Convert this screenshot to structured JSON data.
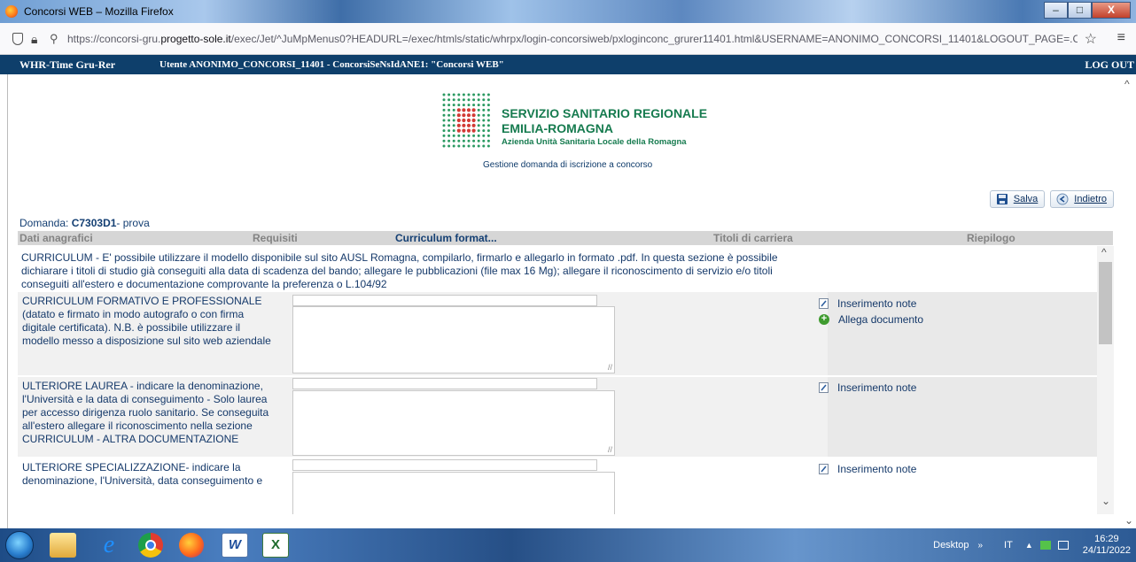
{
  "window": {
    "title": "Concorsi WEB – Mozilla Firefox",
    "minimize": "–",
    "maximize": "□",
    "close": "X"
  },
  "address_bar": {
    "url_prefix": "https://concorsi-gru.",
    "url_domain": "progetto-sole.it",
    "url_suffix": "/exec/Jet/^JuMpMenus0?HEADURL=/exec/htmls/static/whrpx/login-concorsiweb/pxloginconc_grurer11401.html&USERNAME=ANONIMO_CONCORSI_11401&LOGOUT_PAGE=.CLOSE&N",
    "bookmark_icon": "star-icon",
    "menu_icon": "hamburger-icon"
  },
  "app_header": {
    "app_name": "WHR-Time Gru-Rer",
    "user_text": "Utente ANONIMO_CONCORSI_11401 - ConcorsiSeNsIdANE1: \"Concorsi WEB\"",
    "logout": "LOG OUT"
  },
  "logo": {
    "line1": "SERVIZIO SANITARIO REGIONALE",
    "line2": "EMILIA-ROMAGNA",
    "line3": "Azienda Unità Sanitaria Locale della Romagna"
  },
  "subtitle": "Gestione domanda di iscrizione a concorso",
  "toolbar": {
    "save_label": "Salva",
    "back_label": "Indietro"
  },
  "domanda": {
    "label": "Domanda:",
    "code": "C7303D1",
    "suffix": "- prova"
  },
  "tabs": [
    {
      "label": "Dati anagrafici"
    },
    {
      "label": "Requisiti"
    },
    {
      "label": "Curriculum format..."
    },
    {
      "label": "Titoli di carriera"
    },
    {
      "label": "Riepilogo"
    }
  ],
  "active_tab": "Curriculum format...",
  "intro": "CURRICULUM - E' possibile utilizzare il modello disponibile sul sito AUSL Romagna, compilarlo, firmarlo e allegarlo in formato .pdf. In questa sezione è possibile dichiarare i titoli di studio già conseguiti alla data di scadenza del bando; allegare le pubblicazioni (file max 16 Mg); allegare il riconoscimento di servizio e/o titoli conseguiti all'estero e documentazione comprovante la preferenza o L.104/92",
  "rows": [
    {
      "label": "CURRICULUM FORMATIVO E PROFESSIONALE (datato e firmato in modo autografo o con firma digitale certificata). N.B. è possibile utilizzare il modello messo a disposizione sul sito web aziendale",
      "input_value": "",
      "textarea_value": "",
      "actions": [
        "Inserimento note",
        "Allega documento"
      ]
    },
    {
      "label": "ULTERIORE LAUREA - indicare la denominazione, l'Università e la data di conseguimento - Solo laurea per accesso dirigenza ruolo sanitario. Se conseguita all'estero allegare il riconoscimento nella sezione CURRICULUM - ALTRA DOCUMENTAZIONE",
      "input_value": "",
      "textarea_value": "",
      "actions": [
        "Inserimento note"
      ]
    },
    {
      "label": "ULTERIORE SPECIALIZZAZIONE- indicare la denominazione, l'Università, data conseguimento e",
      "input_value": "",
      "textarea_value": "",
      "actions": [
        "Inserimento note"
      ]
    }
  ],
  "taskbar": {
    "desktop": "Desktop",
    "chevron": "»",
    "lang": "IT",
    "up_arrow": "▲",
    "time": "16:29",
    "date": "24/11/2022"
  }
}
